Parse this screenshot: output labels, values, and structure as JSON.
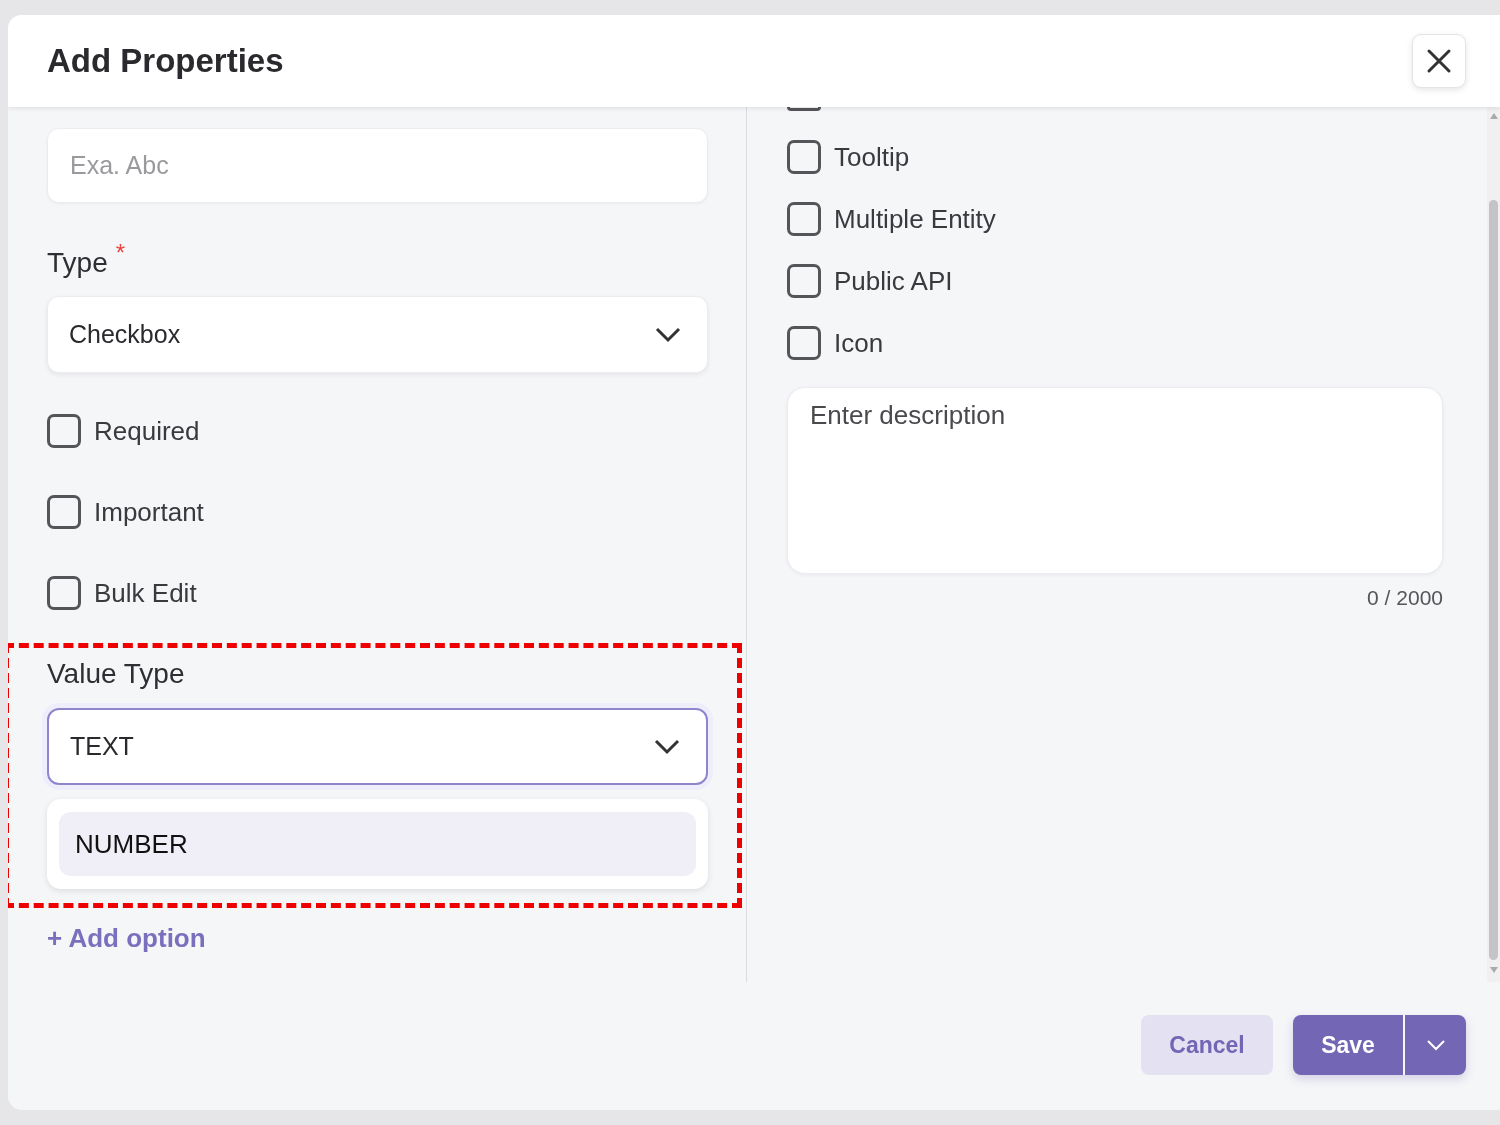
{
  "dialog": {
    "title": "Add Properties"
  },
  "name_field": {
    "placeholder": "Exa. Abc"
  },
  "type_field": {
    "label": "Type",
    "required_mark": "*",
    "value": "Checkbox"
  },
  "left_options": [
    {
      "label": "Required",
      "checked": false
    },
    {
      "label": "Important",
      "checked": false
    },
    {
      "label": "Bulk Edit",
      "checked": false
    }
  ],
  "value_type": {
    "label": "Value Type",
    "value": "TEXT",
    "focused": true,
    "highlighted": true,
    "menu": [
      {
        "label": "NUMBER",
        "selected": true
      }
    ]
  },
  "add_option": "+ Add option",
  "cut_off_option": {
    "checked": false
  },
  "right_options": [
    {
      "label": "Tooltip",
      "checked": false
    },
    {
      "label": "Multiple Entity",
      "checked": false
    },
    {
      "label": "Public API",
      "checked": false
    },
    {
      "label": "Icon",
      "checked": false
    }
  ],
  "description": {
    "placeholder": "Enter description",
    "counter": "0 / 2000"
  },
  "buttons": {
    "cancel": "Cancel",
    "save": "Save"
  }
}
